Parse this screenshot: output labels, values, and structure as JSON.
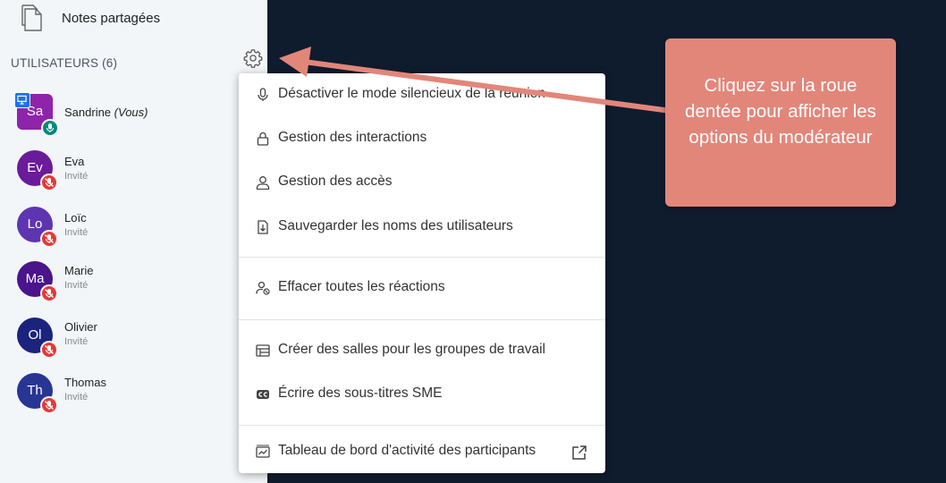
{
  "sidebar": {
    "notes_label": "Notes partagées",
    "users_header": "UTILISATEURS (6)",
    "users": [
      {
        "initials": "Sa",
        "name": "Sandrine",
        "suffix": "(Vous)",
        "role": "",
        "color": "#8e24aa",
        "badge": "mic-on",
        "presenter": true
      },
      {
        "initials": "Ev",
        "name": "Eva",
        "suffix": "",
        "role": "Invité",
        "color": "#6a1b9a",
        "badge": "mic-off",
        "presenter": false
      },
      {
        "initials": "Lo",
        "name": "Loïc",
        "suffix": "",
        "role": "Invité",
        "color": "#5e35b1",
        "badge": "mic-off",
        "presenter": false
      },
      {
        "initials": "Ma",
        "name": "Marie",
        "suffix": "",
        "role": "Invité",
        "color": "#4a148c",
        "badge": "mic-off",
        "presenter": false
      },
      {
        "initials": "Ol",
        "name": "Olivier",
        "suffix": "",
        "role": "Invité",
        "color": "#1a237e",
        "badge": "mic-off",
        "presenter": false
      },
      {
        "initials": "Th",
        "name": "Thomas",
        "suffix": "",
        "role": "Invité",
        "color": "#283593",
        "badge": "mic-off",
        "presenter": false
      }
    ]
  },
  "menu": {
    "items": [
      {
        "label": "Désactiver le mode silencieux de la réunion",
        "icon": "microphone-icon"
      },
      {
        "label": "Gestion des interactions",
        "icon": "lock-icon"
      },
      {
        "label": "Gestion des accès",
        "icon": "user-icon"
      },
      {
        "label": "Sauvegarder les noms des utilisateurs",
        "icon": "download-file-icon"
      },
      {
        "label": "Effacer toutes les réactions",
        "icon": "user-clear-icon"
      },
      {
        "label": "Créer des salles pour les groupes de travail",
        "icon": "rooms-icon"
      },
      {
        "label": "Écrire des sous-titres SME",
        "icon": "closed-caption-icon"
      },
      {
        "label": "Tableau de bord d'activité des participants",
        "icon": "dashboard-icon"
      }
    ]
  },
  "callout": {
    "text": "Cliquez sur la roue dentée pour afficher les options du modérateur"
  },
  "colors": {
    "background": "#0f1c2e",
    "sidebar": "#f3f6f9",
    "callout": "#e2867a",
    "mic_on": "#00897b",
    "mic_off": "#e53935",
    "arrow": "#e2867a"
  }
}
